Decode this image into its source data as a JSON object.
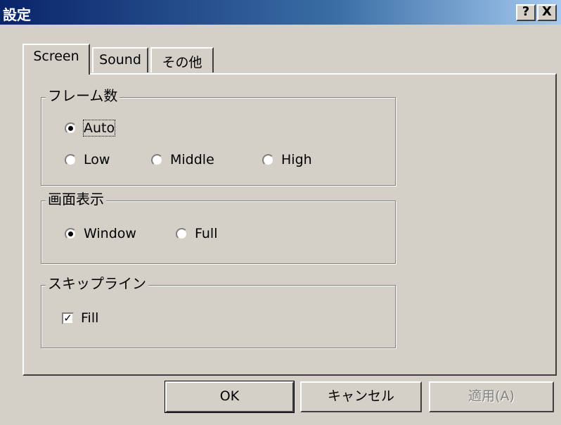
{
  "window": {
    "title": "設定",
    "help_label": "?",
    "close_label": "X"
  },
  "tabs": [
    {
      "label": "Screen",
      "active": true
    },
    {
      "label": "Sound",
      "active": false
    },
    {
      "label": "その他",
      "active": false
    }
  ],
  "frames_group": {
    "title": "フレーム数",
    "options": [
      {
        "label": "Auto",
        "selected": true
      },
      {
        "label": "Low",
        "selected": false
      },
      {
        "label": "Middle",
        "selected": false
      },
      {
        "label": "High",
        "selected": false
      }
    ]
  },
  "display_group": {
    "title": "画面表示",
    "options": [
      {
        "label": "Window",
        "selected": true
      },
      {
        "label": "Full",
        "selected": false
      }
    ]
  },
  "skipline_group": {
    "title": "スキップライン",
    "fill_label": "Fill",
    "fill_checked": true
  },
  "buttons": {
    "ok": "OK",
    "cancel": "キャンセル",
    "apply": "適用(A)"
  }
}
